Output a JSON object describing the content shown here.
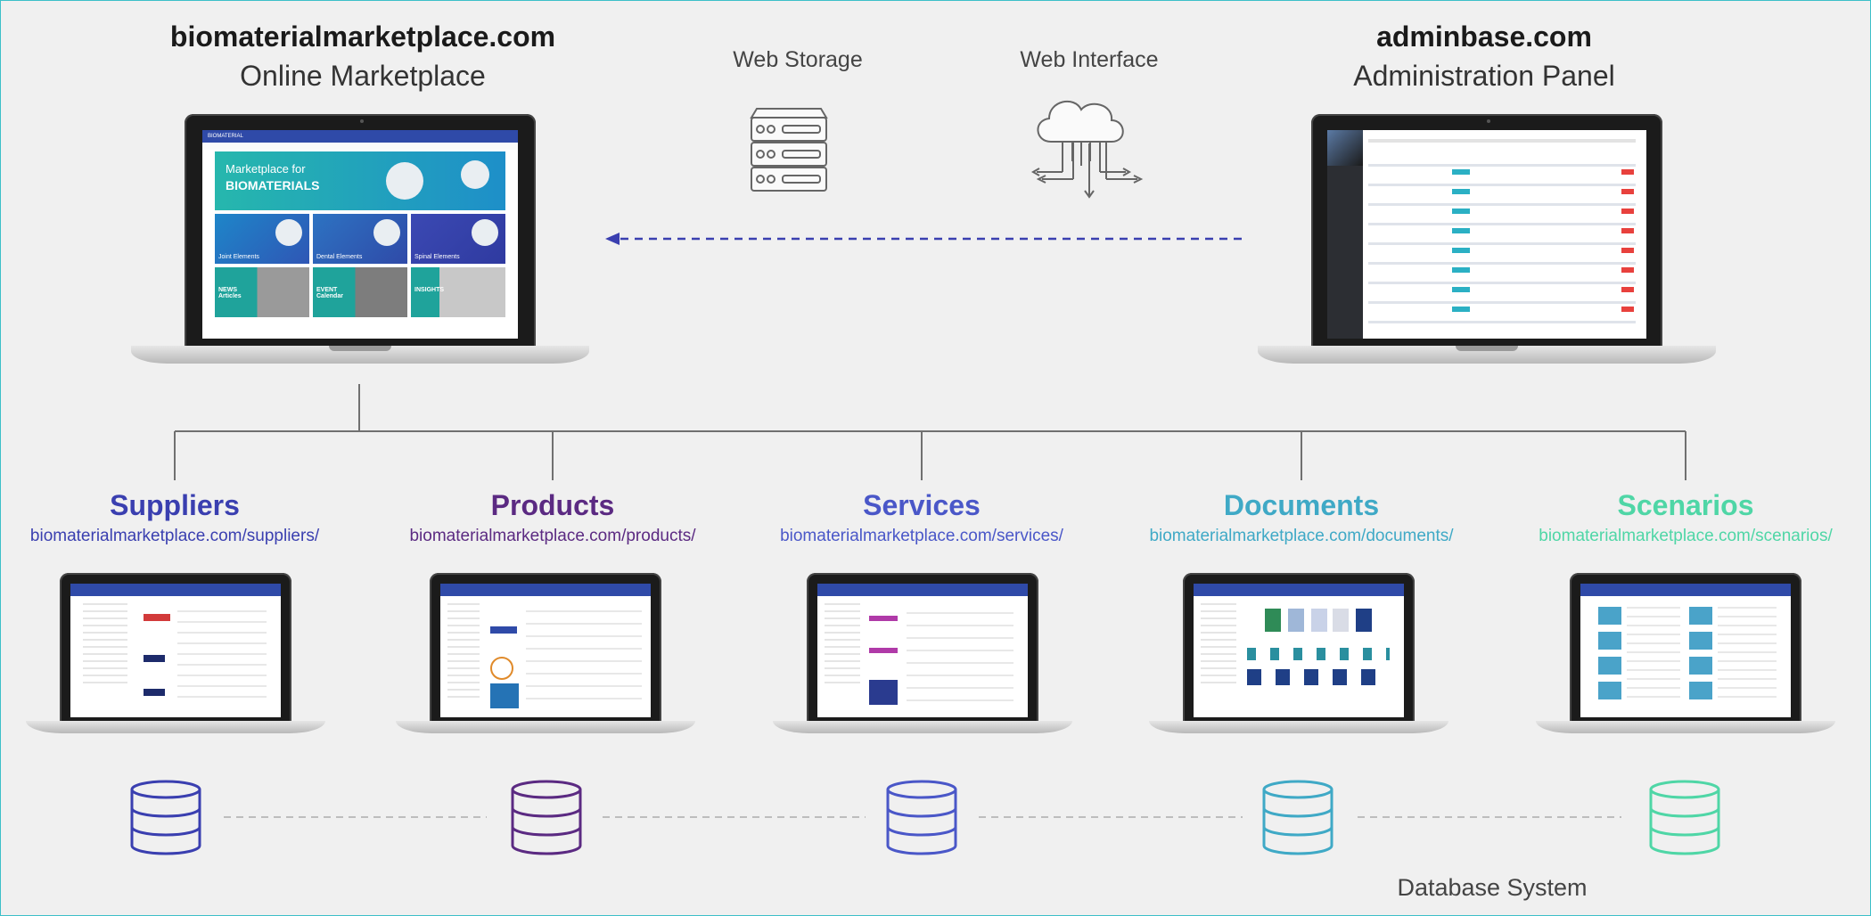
{
  "marketplace": {
    "domain": "biomaterialmarketplace.com",
    "subtitle": "Online Marketplace"
  },
  "admin": {
    "domain": "adminbase.com",
    "subtitle": "Administration Panel"
  },
  "web_storage_label": "Web Storage",
  "web_interface_label": "Web Interface",
  "database_system_label": "Database System",
  "marketplace_screen": {
    "brand": "BIOMATERIAL",
    "hero_line1": "Marketplace for",
    "hero_line2": "BIOMATERIALS",
    "tiles": [
      "Joint Elements",
      "Dental Elements",
      "Spinal Elements"
    ],
    "tiles_bottom": [
      "NEWS Articles",
      "EVENT Calendar",
      "INSIGHTS"
    ]
  },
  "sections": [
    {
      "title": "Suppliers",
      "url": "biomaterialmarketplace.com/suppliers/",
      "color": "#3a3fb0"
    },
    {
      "title": "Products",
      "url": "biomaterialmarketplace.com/products/",
      "color": "#5b2a82"
    },
    {
      "title": "Services",
      "url": "biomaterialmarketplace.com/services/",
      "color": "#4a57c8"
    },
    {
      "title": "Documents",
      "url": "biomaterialmarketplace.com/documents/",
      "color": "#3fa9c6"
    },
    {
      "title": "Scenarios",
      "url": "biomaterialmarketplace.com/scenarios/",
      "color": "#4fd6a6"
    }
  ],
  "colors": {
    "border": "#3cc0c8",
    "arrow": "#3a3fb0",
    "connector": "#707070",
    "background": "#f0f0f0"
  },
  "icons": [
    "server-icon",
    "cloud-interface-icon",
    "database-icon",
    "laptop-icon",
    "dashed-arrow-left-icon"
  ]
}
